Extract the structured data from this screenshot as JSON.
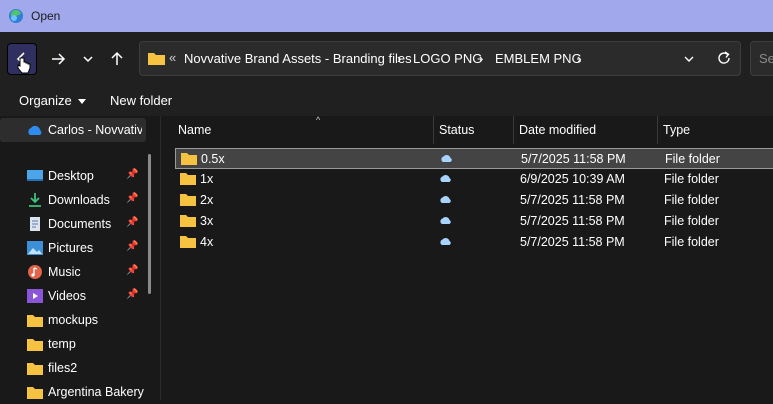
{
  "window": {
    "title": "Open"
  },
  "address_bar": {
    "crumbs": [
      "Novvative Brand Assets - Branding files",
      "LOGO PNG",
      "EMBLEM PNG"
    ],
    "overflow_symbol": "«",
    "separator": "›",
    "search_placeholder": "Se"
  },
  "command_bar": {
    "organize": "Organize",
    "new_folder": "New folder"
  },
  "sidebar": {
    "onedrive": "Carlos - Novvative",
    "items": [
      {
        "label": "Desktop",
        "icon": "desktop-icon",
        "pinned": true
      },
      {
        "label": "Downloads",
        "icon": "download-icon",
        "pinned": true
      },
      {
        "label": "Documents",
        "icon": "documents-icon",
        "pinned": true
      },
      {
        "label": "Pictures",
        "icon": "pictures-icon",
        "pinned": true
      },
      {
        "label": "Music",
        "icon": "music-icon",
        "pinned": true
      },
      {
        "label": "Videos",
        "icon": "videos-icon",
        "pinned": true
      },
      {
        "label": "mockups",
        "icon": "folder-icon",
        "pinned": false
      },
      {
        "label": "temp",
        "icon": "folder-icon",
        "pinned": false
      },
      {
        "label": "files2",
        "icon": "folder-icon",
        "pinned": false
      },
      {
        "label": "Argentina Bakery",
        "icon": "folder-icon",
        "pinned": false
      }
    ]
  },
  "columns": {
    "name": "Name",
    "status": "Status",
    "date": "Date modified",
    "type": "Type"
  },
  "files": [
    {
      "name": "0.5x",
      "date": "5/7/2025 11:58 PM",
      "type": "File folder",
      "selected": true
    },
    {
      "name": "1x",
      "date": "6/9/2025 10:39 AM",
      "type": "File folder",
      "selected": false
    },
    {
      "name": "2x",
      "date": "5/7/2025 11:58 PM",
      "type": "File folder",
      "selected": false
    },
    {
      "name": "3x",
      "date": "5/7/2025 11:58 PM",
      "type": "File folder",
      "selected": false
    },
    {
      "name": "4x",
      "date": "5/7/2025 11:58 PM",
      "type": "File folder",
      "selected": false
    }
  ],
  "colors": {
    "titlebar": "#a1a8ec",
    "folder": "#f5c242",
    "cloud": "#a9d3ff",
    "selection": "#444444"
  }
}
